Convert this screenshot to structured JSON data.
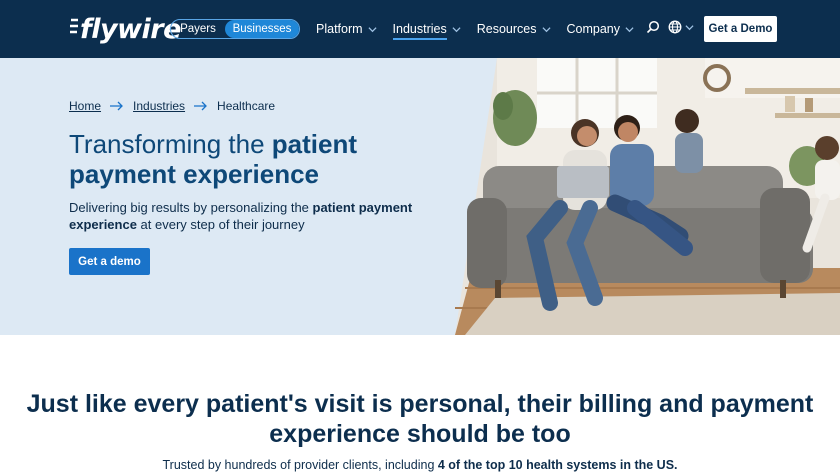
{
  "nav": {
    "logo": "flywire",
    "audience": {
      "payers": "Payers",
      "businesses": "Businesses"
    },
    "menu": [
      {
        "label": "Platform"
      },
      {
        "label": "Industries"
      },
      {
        "label": "Resources"
      },
      {
        "label": "Company"
      }
    ],
    "cta": "Get a Demo",
    "icons": [
      "search-icon",
      "globe-icon",
      "chevron-down-icon"
    ]
  },
  "hero": {
    "breadcrumb": {
      "home": "Home",
      "industries": "Industries",
      "current": "Healthcare"
    },
    "title_normal": "Transforming the ",
    "title_bold": "patient payment experience",
    "sub_1": "Delivering big results by personalizing the ",
    "sub_bold": "patient payment experience",
    "sub_2": " at every step of their journey",
    "cta": "Get a demo"
  },
  "section": {
    "title": "Just like every patient's visit is personal, their billing and payment experience should be too",
    "sub_1": "Trusted by hundreds of provider clients, including ",
    "sub_bold": "4 of the top 10 health systems in the US."
  },
  "colors": {
    "nav_bg": "#0c2e4e",
    "accent": "#1f87d8",
    "hero_bg": "#dde9f4",
    "title_blue": "#0e4878"
  }
}
